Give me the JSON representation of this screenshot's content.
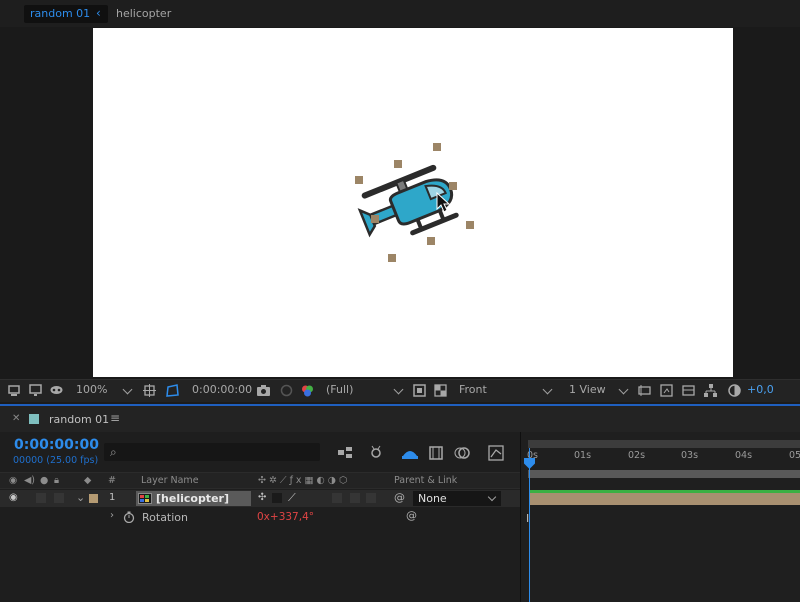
{
  "comp_tabs": {
    "active": "random 01",
    "other": "helicopter"
  },
  "viewer_toolbar": {
    "zoom": "100%",
    "timecode": "0:00:00:00",
    "resolution": "(Full)",
    "view": "Front",
    "views": "1 View",
    "exposure": "+0,0"
  },
  "timeline": {
    "comp_name": "random 01",
    "time": "0:00:00:00",
    "frame_info": "00000 (25.00 fps)",
    "columns": {
      "hash": "#",
      "layer_name": "Layer Name",
      "parent": "Parent & Link"
    },
    "layer": {
      "number": "1",
      "name": "[helicopter]",
      "parent": "None",
      "label_color": "#b59b73"
    },
    "property": {
      "name": "Rotation",
      "value": "0x+337,4°"
    },
    "ruler_ticks": [
      "0s",
      "01s",
      "02s",
      "03s",
      "04s",
      "05"
    ],
    "accent_color": "#2d8ceb"
  }
}
